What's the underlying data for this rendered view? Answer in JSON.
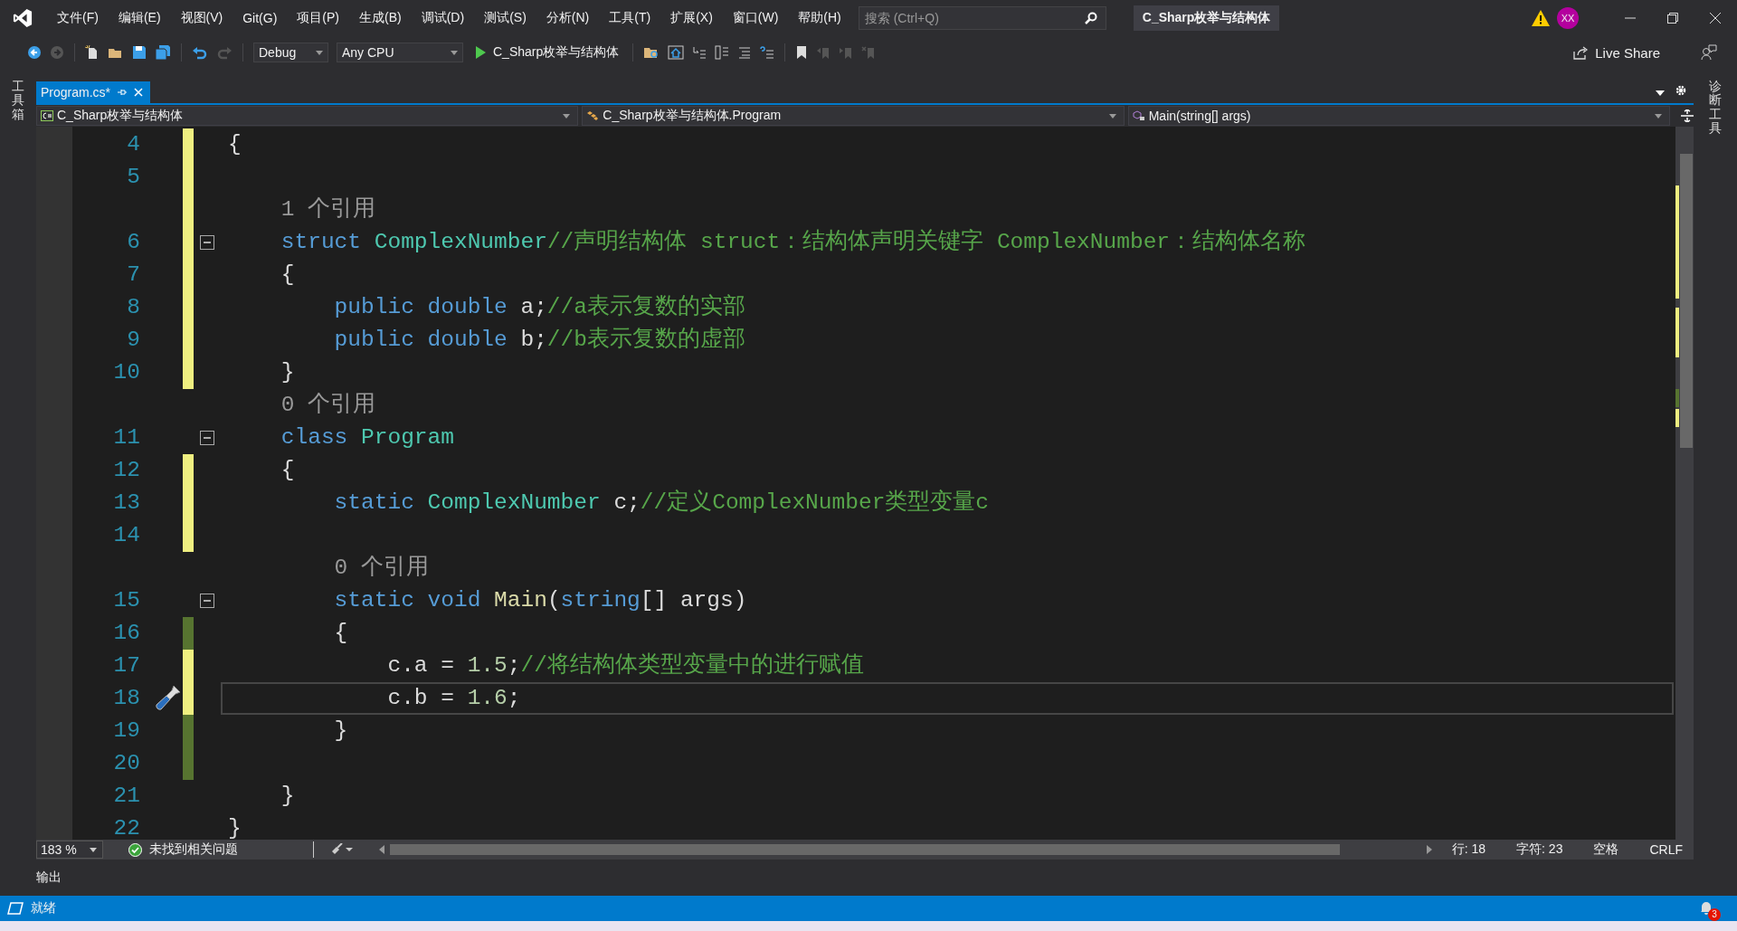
{
  "menu": [
    "文件(F)",
    "编辑(E)",
    "视图(V)",
    "Git(G)",
    "项目(P)",
    "生成(B)",
    "调试(D)",
    "测试(S)",
    "分析(N)",
    "工具(T)",
    "扩展(X)",
    "窗口(W)",
    "帮助(H)"
  ],
  "search": {
    "placeholder": "搜索 (Ctrl+Q)"
  },
  "solution_name": "C_Sharp枚举与结构体",
  "account": {
    "initials": "XX"
  },
  "toolbar": {
    "configuration": "Debug",
    "platform": "Any CPU",
    "start": "C_Sharp枚举与结构体",
    "live_share": "Live Share"
  },
  "left_rail": {
    "label": "工具箱"
  },
  "right_rail": {
    "label": "诊断工具"
  },
  "tabs": [
    {
      "label": "Program.cs*",
      "selected": true
    }
  ],
  "nav": {
    "project": "C_Sharp枚举与结构体",
    "type": "C_Sharp枚举与结构体.Program",
    "member": "Main(string[] args)"
  },
  "lines": [
    {
      "kind": "code",
      "number": "4",
      "modified": true,
      "saved": false,
      "tokens": [
        {
          "t": "{",
          "kind": "plain"
        }
      ]
    },
    {
      "kind": "code",
      "number": "5",
      "modified": true,
      "saved": false
    },
    {
      "kind": "lens",
      "modified": true,
      "saved": false,
      "text": "    1 个引用"
    },
    {
      "kind": "code",
      "number": "6",
      "modified": true,
      "saved": false,
      "expanded": true,
      "tokens": [
        {
          "t": "    struct ",
          "kind": "keyword"
        },
        {
          "t": "ComplexNumber",
          "kind": "type"
        },
        {
          "t": "//声明结构体 struct：结构体声明关键字 ComplexNumber：结构体名称",
          "kind": "comment"
        }
      ]
    },
    {
      "kind": "code",
      "number": "7",
      "modified": true,
      "saved": false,
      "tokens": [
        {
          "t": "    {",
          "kind": "plain"
        }
      ]
    },
    {
      "kind": "code",
      "number": "8",
      "modified": true,
      "saved": false,
      "tokens": [
        {
          "t": "        public double ",
          "kind": "keyword"
        },
        {
          "t": "a;",
          "kind": "plain"
        },
        {
          "t": "//a表示复数的实部",
          "kind": "comment"
        }
      ]
    },
    {
      "kind": "code",
      "number": "9",
      "modified": true,
      "saved": false,
      "tokens": [
        {
          "t": "        public double ",
          "kind": "keyword"
        },
        {
          "t": "b;",
          "kind": "plain"
        },
        {
          "t": "//b表示复数的虚部",
          "kind": "comment"
        }
      ]
    },
    {
      "kind": "code",
      "number": "10",
      "modified": true,
      "saved": false,
      "tokens": [
        {
          "t": "    }",
          "kind": "plain"
        }
      ]
    },
    {
      "kind": "lens",
      "modified": false,
      "saved": false,
      "text": "    0 个引用"
    },
    {
      "kind": "code",
      "number": "11",
      "modified": false,
      "saved": false,
      "expanded": true,
      "tokens": [
        {
          "t": "    class ",
          "kind": "keyword"
        },
        {
          "t": "Program",
          "kind": "type"
        }
      ]
    },
    {
      "kind": "code",
      "number": "12",
      "modified": true,
      "saved": false,
      "tokens": [
        {
          "t": "    {",
          "kind": "plain"
        }
      ]
    },
    {
      "kind": "code",
      "number": "13",
      "modified": true,
      "saved": false,
      "tokens": [
        {
          "t": "        static ",
          "kind": "keyword"
        },
        {
          "t": "ComplexNumber",
          "kind": "type"
        },
        {
          "t": " c;",
          "kind": "plain"
        },
        {
          "t": "//定义ComplexNumber类型变量c",
          "kind": "comment"
        }
      ]
    },
    {
      "kind": "code",
      "number": "14",
      "modified": true,
      "saved": false
    },
    {
      "kind": "lens",
      "modified": false,
      "saved": false,
      "text": "        0 个引用"
    },
    {
      "kind": "code",
      "number": "15",
      "modified": false,
      "saved": false,
      "expanded": true,
      "tokens": [
        {
          "t": "        static void ",
          "kind": "keyword"
        },
        {
          "t": "Main",
          "kind": "method"
        },
        {
          "t": "(",
          "kind": "plain"
        },
        {
          "t": "string",
          "kind": "keyword"
        },
        {
          "t": "[] args)",
          "kind": "plain"
        }
      ]
    },
    {
      "kind": "code",
      "number": "16",
      "modified": true,
      "saved": true,
      "tokens": [
        {
          "t": "        {",
          "kind": "plain"
        }
      ]
    },
    {
      "kind": "code",
      "number": "17",
      "modified": true,
      "saved": false,
      "tokens": [
        {
          "t": "            c.a = ",
          "kind": "plain"
        },
        {
          "t": "1.5",
          "kind": "number"
        },
        {
          "t": ";",
          "kind": "plain"
        },
        {
          "t": "//将结构体类型变量中的进行赋值",
          "kind": "comment"
        }
      ]
    },
    {
      "kind": "code",
      "number": "18",
      "modified": true,
      "saved": false,
      "current": true,
      "quick_action": true,
      "tokens": [
        {
          "t": "            c.b = ",
          "kind": "plain"
        },
        {
          "t": "1.6",
          "kind": "number"
        },
        {
          "t": ";",
          "kind": "plain"
        }
      ]
    },
    {
      "kind": "code",
      "number": "19",
      "modified": true,
      "saved": true,
      "tokens": [
        {
          "t": "        }",
          "kind": "plain"
        }
      ]
    },
    {
      "kind": "code",
      "number": "20",
      "modified": true,
      "saved": true
    },
    {
      "kind": "code",
      "number": "21",
      "modified": false,
      "saved": false,
      "tokens": [
        {
          "t": "    }",
          "kind": "plain"
        }
      ]
    },
    {
      "kind": "code",
      "number": "22",
      "modified": false,
      "saved": false,
      "tokens": [
        {
          "t": "}",
          "kind": "plain"
        }
      ]
    }
  ],
  "editor_status": {
    "zoom": "183 %",
    "issues": "未找到相关问题",
    "line": "行: 18",
    "column": "字符: 23",
    "whitespace": "空格",
    "eol": "CRLF"
  },
  "output_tab": "输出",
  "status": {
    "text": "就绪",
    "notifications": "3"
  }
}
